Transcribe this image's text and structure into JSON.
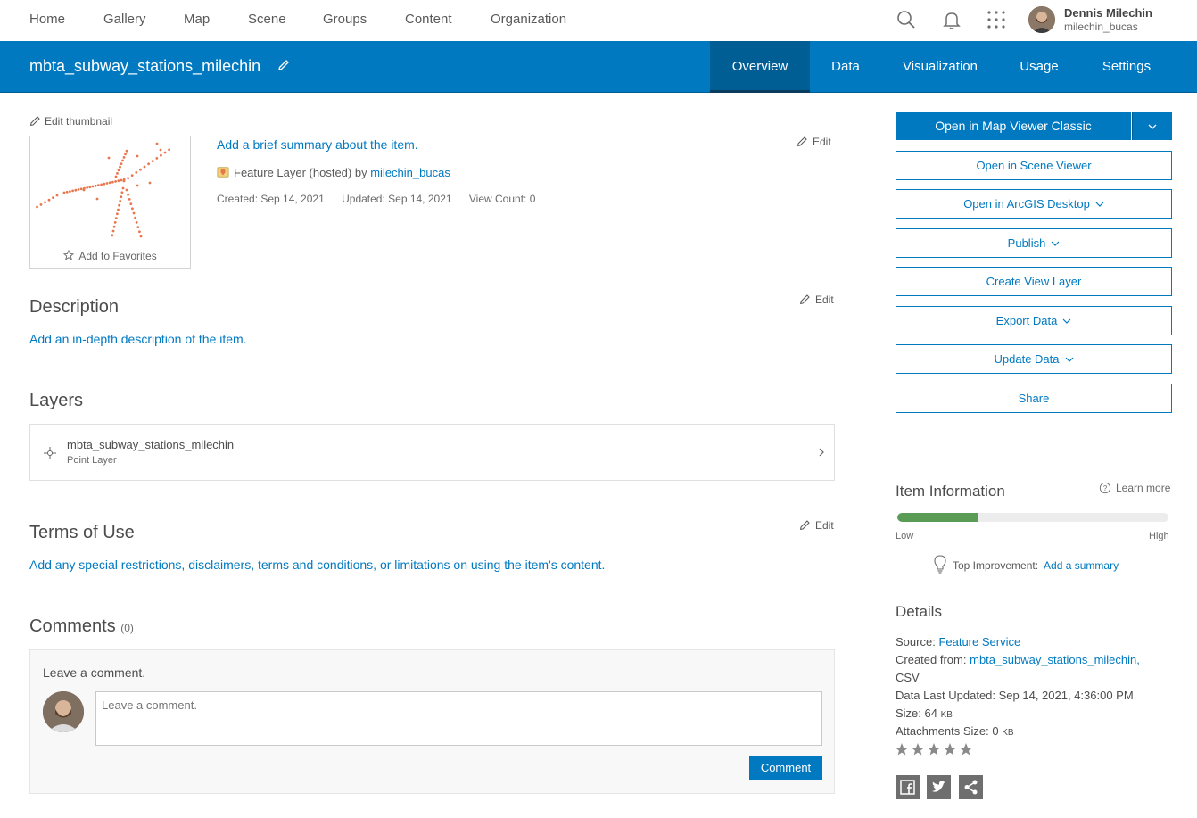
{
  "topnav": {
    "items": [
      "Home",
      "Gallery",
      "Map",
      "Scene",
      "Groups",
      "Content",
      "Organization"
    ],
    "user_name": "Dennis Milechin",
    "user_handle": "milechin_bucas"
  },
  "header": {
    "title": "mbta_subway_stations_milechin",
    "tabs": [
      "Overview",
      "Data",
      "Visualization",
      "Usage",
      "Settings"
    ],
    "active_tab": "Overview"
  },
  "overview": {
    "edit_thumbnail": "Edit thumbnail",
    "add_to_favorites": "Add to Favorites",
    "summary_link": "Add a brief summary about the item.",
    "edit_label": "Edit",
    "item_type": "Feature Layer (hosted)",
    "by_label": "by",
    "owner": "milechin_bucas",
    "created": "Created: Sep 14, 2021",
    "updated": "Updated: Sep 14, 2021",
    "view_count": "View Count: 0"
  },
  "description": {
    "heading": "Description",
    "link": "Add an in-depth description of the item."
  },
  "layers": {
    "heading": "Layers",
    "items": [
      {
        "name": "mbta_subway_stations_milechin",
        "type": "Point Layer"
      }
    ]
  },
  "terms": {
    "heading": "Terms of Use",
    "link": "Add any special restrictions, disclaimers, terms and conditions, or limitations on using the item's content."
  },
  "comments": {
    "heading": "Comments",
    "count": "(0)",
    "label": "Leave a comment.",
    "placeholder": "Leave a comment.",
    "button": "Comment"
  },
  "actions": {
    "primary": "Open in Map Viewer Classic",
    "buttons": [
      "Open in Scene Viewer",
      "Open in ArcGIS Desktop",
      "Publish",
      "Create View Layer",
      "Export Data",
      "Update Data",
      "Share"
    ]
  },
  "item_information": {
    "heading": "Item Information",
    "learn_more": "Learn more",
    "score_fraction": 0.3,
    "low": "Low",
    "high": "High",
    "top_improvement_label": "Top Improvement:",
    "top_improvement_link": "Add a summary",
    "meter_color": "#5a9c55"
  },
  "details": {
    "heading": "Details",
    "source_label": "Source:",
    "source_value": "Feature Service",
    "created_from_label": "Created from:",
    "created_from_value": "mbta_subway_stations_milechin,",
    "created_from_extra": "CSV",
    "last_updated": "Data Last Updated: Sep 14, 2021, 4:36:00 PM",
    "size_label": "Size: 64",
    "size_unit": "KB",
    "attachments_label": "Attachments Size: 0",
    "attachments_unit": "KB",
    "rating": 0
  },
  "colors": {
    "brand_blue": "#0079c1",
    "active_tab": "#005e95",
    "map_points": "#e8774e"
  }
}
